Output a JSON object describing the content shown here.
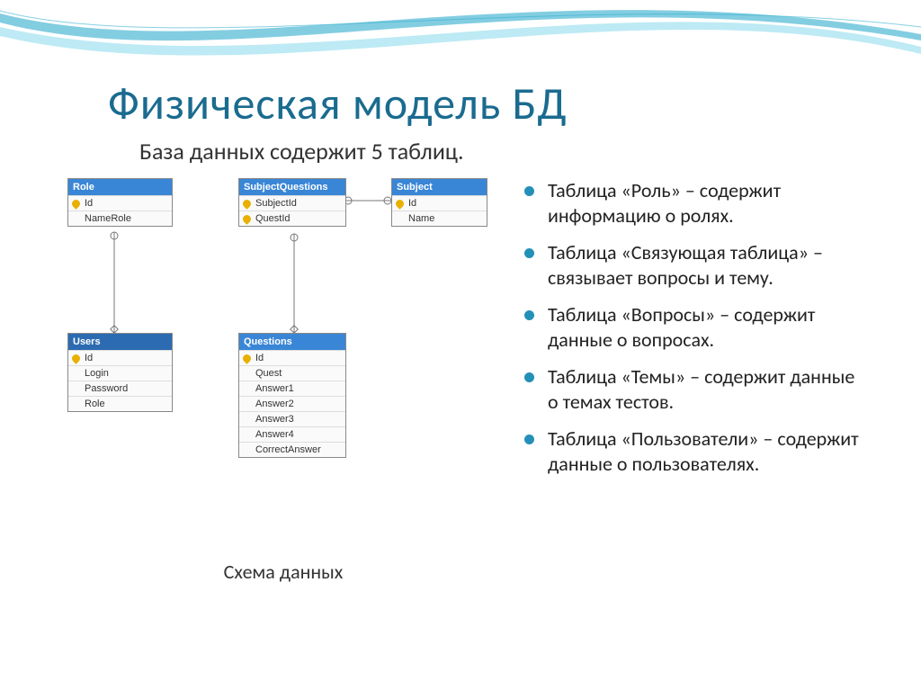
{
  "title": "Физическая модель БД",
  "subtitle": "База данных содержит 5 таблиц.",
  "diagram_caption": "Схема данных",
  "tables": {
    "role": {
      "name": "Role",
      "fields": [
        {
          "label": "Id",
          "key": true
        },
        {
          "label": "NameRole",
          "key": false
        }
      ]
    },
    "subjectQuestions": {
      "name": "SubjectQuestions",
      "fields": [
        {
          "label": "SubjectId",
          "key": true
        },
        {
          "label": "QuestId",
          "key": true
        }
      ]
    },
    "subject": {
      "name": "Subject",
      "fields": [
        {
          "label": "Id",
          "key": true
        },
        {
          "label": "Name",
          "key": false
        }
      ]
    },
    "users": {
      "name": "Users",
      "fields": [
        {
          "label": "Id",
          "key": true
        },
        {
          "label": "Login",
          "key": false
        },
        {
          "label": "Password",
          "key": false
        },
        {
          "label": "Role",
          "key": false
        }
      ]
    },
    "questions": {
      "name": "Questions",
      "fields": [
        {
          "label": "Id",
          "key": true
        },
        {
          "label": "Quest",
          "key": false
        },
        {
          "label": "Answer1",
          "key": false
        },
        {
          "label": "Answer2",
          "key": false
        },
        {
          "label": "Answer3",
          "key": false
        },
        {
          "label": "Answer4",
          "key": false
        },
        {
          "label": "CorrectAnswer",
          "key": false
        }
      ]
    }
  },
  "bullets": [
    "Таблица «Роль» – содержит информацию о ролях.",
    "Таблица «Связующая таблица» – связывает вопросы и тему.",
    "Таблица «Вопросы» – содержит данные о вопросах.",
    "Таблица «Темы» – содержит данные о темах тестов.",
    "Таблица «Пользователи» – содержит данные о пользователях."
  ]
}
